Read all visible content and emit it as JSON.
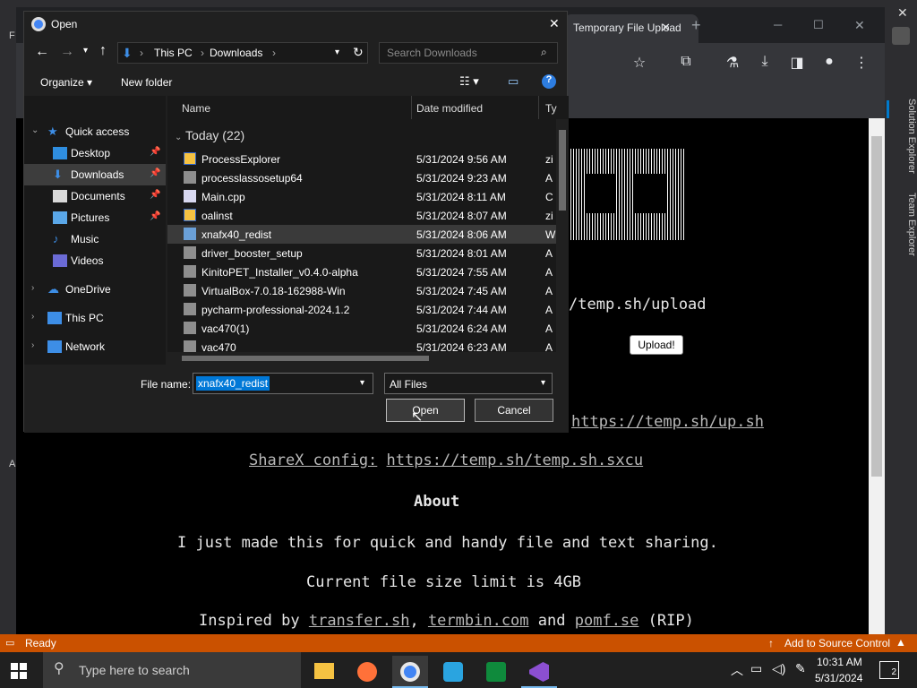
{
  "vs": {
    "left_label": "F",
    "left_label2": "A",
    "right_tabs": [
      "Solution Explorer",
      "Team Explorer"
    ],
    "status_ready": "Ready",
    "status_right": "Add to Source Control",
    "accent": "#ca5100"
  },
  "chrome": {
    "tab_title": "Temporary File Upload",
    "tab_close": "✕",
    "new_tab": "+",
    "win_min": "─",
    "win_max": "☐",
    "win_close": "✕",
    "outer_close": "✕"
  },
  "page": {
    "upload_path": "/temp.sh/upload",
    "upload_button": "Upload!",
    "script_link": "https://temp.sh/up.sh",
    "sharex_label": "ShareX config:",
    "sharex_link": "https://temp.sh/temp.sh.sxcu",
    "about_heading": "About",
    "about_line1": "I just made this for quick and handy file and text sharing.",
    "about_line2": "Current file size limit is 4GB",
    "inspired_prefix": "Inspired by",
    "inspired_link1": "transfer.sh",
    "inspired_sep": ",",
    "inspired_link2": "termbin.com",
    "inspired_and": "and",
    "inspired_link3": "pomf.se",
    "inspired_suffix": "(RIP)"
  },
  "dialog": {
    "title": "Open",
    "close": "✕",
    "breadcrumb": [
      "This PC",
      "Downloads"
    ],
    "search_placeholder": "Search Downloads",
    "organize_label": "Organize ▾",
    "new_folder_label": "New folder",
    "nav": [
      {
        "label": "Quick access",
        "icon": "star-icon"
      },
      {
        "label": "Desktop",
        "icon": "desktop-icon",
        "pinned": true
      },
      {
        "label": "Downloads",
        "icon": "download-icon",
        "pinned": true,
        "selected": true
      },
      {
        "label": "Documents",
        "icon": "document-icon",
        "pinned": true
      },
      {
        "label": "Pictures",
        "icon": "pictures-icon",
        "pinned": true
      },
      {
        "label": "Music",
        "icon": "music-icon"
      },
      {
        "label": "Videos",
        "icon": "videos-icon"
      },
      {
        "label": "OneDrive",
        "icon": "cloud-icon"
      },
      {
        "label": "This PC",
        "icon": "computer-icon"
      },
      {
        "label": "Network",
        "icon": "network-icon"
      }
    ],
    "columns": {
      "name": "Name",
      "date": "Date modified",
      "type": "Ty"
    },
    "group_label": "Today (22)",
    "files": [
      {
        "name": "ProcessExplorer",
        "date": "5/31/2024 9:56 AM",
        "type": "zi",
        "icon": "zip-icon"
      },
      {
        "name": "processlassosetup64",
        "date": "5/31/2024 9:23 AM",
        "type": "A",
        "icon": "installer-icon"
      },
      {
        "name": "Main.cpp",
        "date": "5/31/2024 8:11 AM",
        "type": "C",
        "icon": "cpp-file-icon"
      },
      {
        "name": "oalinst",
        "date": "5/31/2024 8:07 AM",
        "type": "zi",
        "icon": "zip-icon"
      },
      {
        "name": "xnafx40_redist",
        "date": "5/31/2024 8:06 AM",
        "type": "W",
        "icon": "msi-icon",
        "highlight": true
      },
      {
        "name": "driver_booster_setup",
        "date": "5/31/2024 8:01 AM",
        "type": "A",
        "icon": "installer-icon"
      },
      {
        "name": "KinitoPET_Installer_v0.4.0-alpha",
        "date": "5/31/2024 7:55 AM",
        "type": "A",
        "icon": "installer-icon"
      },
      {
        "name": "VirtualBox-7.0.18-162988-Win",
        "date": "5/31/2024 7:45 AM",
        "type": "A",
        "icon": "installer-icon"
      },
      {
        "name": "pycharm-professional-2024.1.2",
        "date": "5/31/2024 7:44 AM",
        "type": "A",
        "icon": "installer-icon"
      },
      {
        "name": "vac470(1)",
        "date": "5/31/2024 6:24 AM",
        "type": "A",
        "icon": "installer-icon"
      },
      {
        "name": "vac470",
        "date": "5/31/2024 6:23 AM",
        "type": "A",
        "icon": "installer-icon"
      }
    ],
    "filename_label": "File name:",
    "filename_value": "xnafx40_redist",
    "filetype_value": "All Files",
    "open_button": "Open",
    "cancel_button": "Cancel"
  },
  "taskbar": {
    "search_placeholder": "Type here to search",
    "time": "10:31 AM",
    "date": "5/31/2024",
    "notif_count": "2"
  }
}
